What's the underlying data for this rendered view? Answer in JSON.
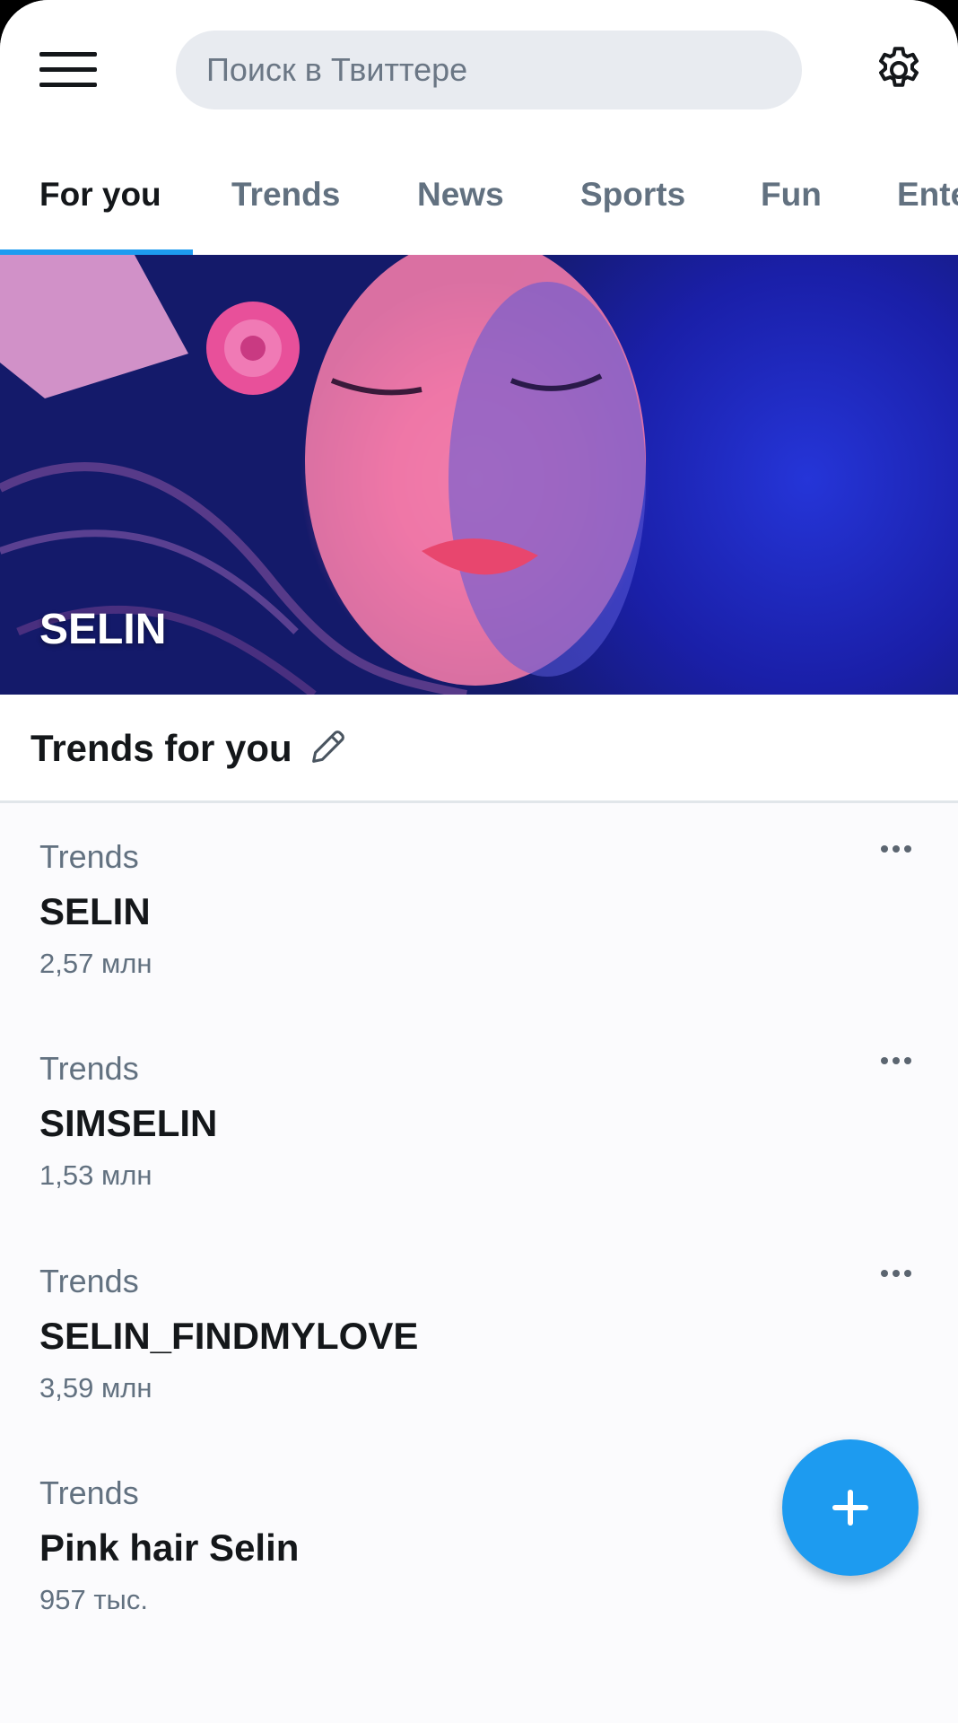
{
  "search": {
    "placeholder": "Поиск в Твиттере"
  },
  "tabs": [
    {
      "label": "For you",
      "active": true
    },
    {
      "label": "Trends"
    },
    {
      "label": "News"
    },
    {
      "label": "Sports"
    },
    {
      "label": "Fun"
    },
    {
      "label": "Ente"
    }
  ],
  "hero": {
    "title": "SELIN"
  },
  "trends_section": {
    "title": "Trends for you"
  },
  "trends": [
    {
      "category": "Trends",
      "name": "SELIN",
      "count": "2,57 млн"
    },
    {
      "category": "Trends",
      "name": "SIMSELIN",
      "count": "1,53 млн"
    },
    {
      "category": "Trends",
      "name": "SELIN_FINDMYLOVE",
      "count": "3,59 млн"
    },
    {
      "category": "Trends",
      "name": "Pink hair Selin",
      "count": "957 тыс."
    }
  ],
  "colors": {
    "accent": "#1d9bf0",
    "text_primary": "#14171a",
    "text_secondary": "#627180"
  },
  "icons": [
    "menu-icon",
    "settings-gear-icon",
    "edit-pencil-icon",
    "more-dots-icon",
    "plus-icon"
  ]
}
